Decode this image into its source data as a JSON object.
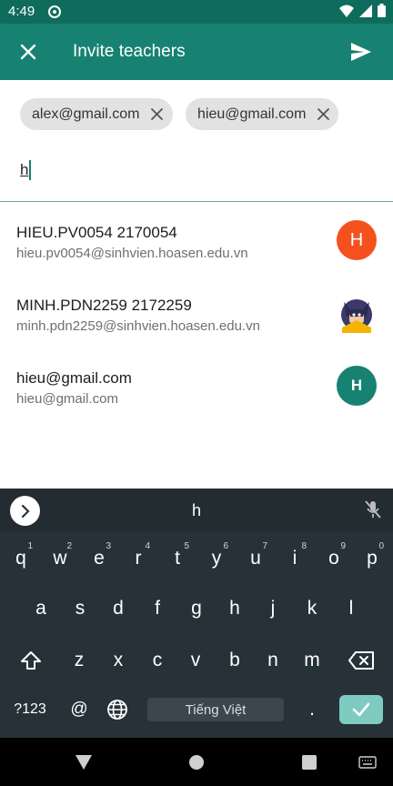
{
  "status": {
    "time": "4:49"
  },
  "app_bar": {
    "title": "Invite teachers"
  },
  "chips": [
    {
      "label": "alex@gmail.com"
    },
    {
      "label": "hieu@gmail.com"
    }
  ],
  "input": {
    "value": "h"
  },
  "suggestions": [
    {
      "name": "HIEU.PV0054 2170054",
      "email": "hieu.pv0054@sinhvien.hoasen.edu.vn",
      "avatar_letter": "H",
      "avatar_color": "#f4511e"
    },
    {
      "name": "MINH.PDN2259 2172259",
      "email": "minh.pdn2259@sinhvien.hoasen.edu.vn",
      "avatar_letter": "",
      "avatar_icon": "batman-avatar-icon"
    },
    {
      "name": "hieu@gmail.com",
      "email": "hieu@gmail.com",
      "avatar_letter": "H",
      "avatar_color": "#178271"
    }
  ],
  "keyboard": {
    "suggestion": "h",
    "row1": [
      "q",
      "w",
      "e",
      "r",
      "t",
      "y",
      "u",
      "i",
      "o",
      "p"
    ],
    "row1_hints": [
      "1",
      "2",
      "3",
      "4",
      "5",
      "6",
      "7",
      "8",
      "9",
      "0"
    ],
    "row2": [
      "a",
      "s",
      "d",
      "f",
      "g",
      "h",
      "j",
      "k",
      "l"
    ],
    "row3": [
      "z",
      "x",
      "c",
      "v",
      "b",
      "n",
      "m"
    ],
    "symbols_label": "?123",
    "at_label": "@",
    "period_label": ".",
    "space_label": "Tiếng Việt"
  },
  "colors": {
    "primary": "#178271",
    "status_bar": "#0f6b5c",
    "keyboard_bg": "#263238",
    "enter_key": "#7fcbc1"
  }
}
